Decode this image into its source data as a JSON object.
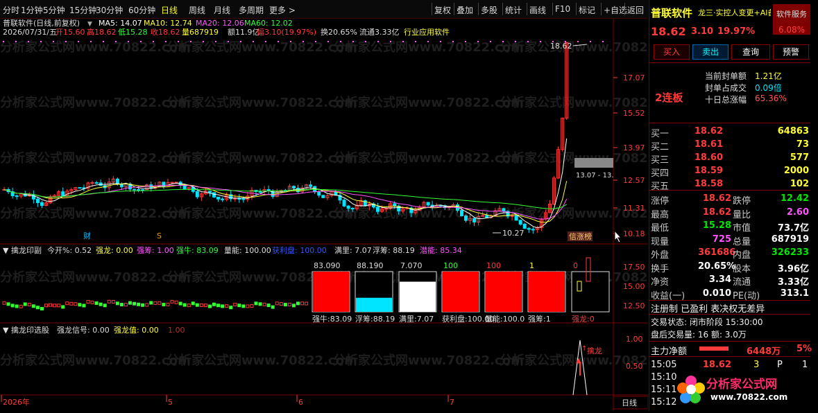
{
  "toolbar": {
    "left_tabs": [
      "分时",
      "1分钟",
      "5分钟",
      "15分钟",
      "30分钟",
      "60分钟",
      "日线",
      "周线",
      "月线",
      "多周期",
      "更多 >"
    ],
    "right_tabs": [
      "复权",
      "叠加",
      "多股",
      "统计",
      "画线",
      "F10",
      "标记",
      "+自选",
      "返回"
    ]
  },
  "main": {
    "title": "普联软件(日线,前复权)",
    "ma": [
      {
        "label": "MA5: 14.07",
        "color": "#ffffff"
      },
      {
        "label": "MA10: 12.74",
        "color": "#ffff33"
      },
      {
        "label": "MA20: 12.06",
        "color": "#ff55ff"
      },
      {
        "label": "MA60: 12.02",
        "color": "#33ff33"
      }
    ],
    "info_date": "2026/07/31/五",
    "info_open": "开15.60",
    "info_high": "高18.62",
    "info_low": "低15.28",
    "info_close": "收18.62",
    "info_vol": "量687919",
    "info_amount": "额11.9亿",
    "info_change": "幅3.10(19.97%)",
    "info_turnover": "换20.65%",
    "info_float": "流通3.33亿",
    "info_industry": "行业应用软件",
    "y_ticks": [
      "17.07",
      "15.52",
      "13.97",
      "12.57",
      "11.31",
      "10.18"
    ],
    "high_label": "18.62",
    "low_label": "10.27",
    "range_label": "13.07 - 13.",
    "marker_cai": "财",
    "marker_s": "S",
    "marker_xin": "信涨榜",
    "watermark": "分析家公式网www.70822.com"
  },
  "panel2": {
    "title": "擒龙印副",
    "items": [
      {
        "text": "今开%: 0.52",
        "color": "#dddddd"
      },
      {
        "text": "强龙: 0.00",
        "color": "#ffff33"
      },
      {
        "text": "强筹: 1.00",
        "color": "#ff55ff"
      },
      {
        "text": "强牛: 83.09",
        "color": "#33ff33"
      },
      {
        "text": "量能: 100.00",
        "color": "#dddddd"
      },
      {
        "text": "获利盘: 100.00",
        "color": "#3355ff"
      },
      {
        "text": "满里: 7.07",
        "color": "#dddddd"
      },
      {
        "text": "浮筹: 88.19",
        "color": "#dddddd"
      },
      {
        "text": "潜能: 85.34",
        "color": "#ff55ff"
      }
    ],
    "y_ticks": [
      "17.50",
      "15.00",
      "12.50"
    ],
    "boxes": [
      {
        "top": "83.090",
        "bottom": "强牛:83.09",
        "top_color": "#dddddd",
        "fill": "#ff0000",
        "fill_level": 1.0
      },
      {
        "top": "88.190",
        "bottom": "浮筹:88.19",
        "top_color": "#dddddd",
        "fill": "#00e5ff",
        "fill_level": 0.35
      },
      {
        "top": "7.070",
        "bottom": "满里:7.07",
        "top_color": "#dddddd",
        "fill": "#ffffff",
        "fill_level": 0.75
      },
      {
        "top": "100",
        "bottom": "获利盘:100.00",
        "top_color": "#33ff33",
        "fill": "#ff0000",
        "fill_level": 1.0
      },
      {
        "top": "100",
        "bottom": "量能:100.0",
        "top_color": "#ff3b3b",
        "fill": "#ff0000",
        "fill_level": 1.0
      },
      {
        "top": "1",
        "bottom": "强筹:1",
        "top_color": "#ffff33",
        "fill": "#ff0000",
        "fill_level": 1.0
      },
      {
        "top": "0",
        "bottom": "强龙:0",
        "top_color": "#ff3b3b",
        "fill": "#000000",
        "fill_level": 0.0
      }
    ]
  },
  "panel3": {
    "title": "擒龙印选股",
    "items": [
      {
        "text": "强龙信号: 0.00",
        "color": "#dddddd"
      },
      {
        "text": "强龙值: 0.00",
        "color": "#ffff33"
      },
      {
        "text": "1.00",
        "color": "#aa3333"
      }
    ],
    "y_ticks": [
      "1.00",
      "0.50"
    ],
    "signal_label": "擒龙"
  },
  "x_axis": {
    "labels": [
      "2026年",
      "5",
      "6",
      "7"
    ],
    "period": "日线"
  },
  "quote": {
    "name": "普联软件",
    "tags": "龙三·实控人变更+AI备",
    "badge": "软件服务",
    "price": "18.62",
    "change": "3.10",
    "pct": "19.97%",
    "badge_pct": "6.08%",
    "buttons": [
      "买入",
      "卖出",
      "查询",
      "预警"
    ],
    "seal_amount_label": "当前封单额",
    "seal_amount": "1.21亿",
    "seal_ratio_label": "封单占成交",
    "seal_ratio": "0.09倍",
    "ten_day_label": "十日总涨幅",
    "ten_day": "65.36%",
    "streak": "2连板",
    "book": [
      {
        "label": "买一",
        "price": "18.62",
        "vol": "64863"
      },
      {
        "label": "买二",
        "price": "18.61",
        "vol": "73"
      },
      {
        "label": "买三",
        "price": "18.60",
        "vol": "577"
      },
      {
        "label": "买四",
        "price": "18.59",
        "vol": "2000"
      },
      {
        "label": "买五",
        "price": "18.58",
        "vol": "102"
      }
    ],
    "stats": [
      {
        "l1": "涨停",
        "v1": "18.62",
        "c1": "red",
        "l2": "跌停",
        "v2": "12.42",
        "c2": "green"
      },
      {
        "l1": "最高",
        "v1": "18.62",
        "c1": "red",
        "l2": "量比",
        "v2": "2.60",
        "c2": "magenta"
      },
      {
        "l1": "最低",
        "v1": "15.28",
        "c1": "green",
        "l2": "市值",
        "v2": "73.7亿",
        "c2": "white"
      },
      {
        "l1": "现量",
        "v1": "725",
        "c1": "magenta",
        "l2": "总量",
        "v2": "687919",
        "c2": "white"
      },
      {
        "l1": "外盘",
        "v1": "361686",
        "c1": "red",
        "l2": "内盘",
        "v2": "326233",
        "c2": "green"
      },
      {
        "l1": "换手",
        "v1": "20.65%",
        "c1": "white",
        "l2": "股本",
        "v2": "3.96亿",
        "c2": "white"
      },
      {
        "l1": "净资",
        "v1": "3.34",
        "c1": "white",
        "l2": "流通",
        "v2": "3.33亿",
        "c2": "white"
      },
      {
        "l1": "收益(一)",
        "v1": "0.010",
        "c1": "white",
        "l2": "PE(动)",
        "v2": "313.1",
        "c2": "white"
      }
    ],
    "reg_line": "注册制 已盈利 表决权无差异",
    "trade_status": "交易状态: 闭市阶段 15:30:00",
    "after_hours": "盘后交易量: 16  额: 3.0万",
    "main_flow_label": "主力净额",
    "main_flow_value": "6448万",
    "main_flow_pct": "5%",
    "ticks": [
      {
        "time": "15:05",
        "price": "18.62",
        "vol": "3",
        "flag": "P",
        "n": "1"
      },
      {
        "time": "15:10",
        "price": "",
        "vol": "",
        "flag": "",
        "n": ""
      },
      {
        "time": "15:11",
        "price": "",
        "vol": "",
        "flag": "",
        "n": ""
      },
      {
        "time": "15:12",
        "price": "",
        "vol": "",
        "flag": "",
        "n": ""
      }
    ],
    "logo_text": "分析家公式网",
    "logo_url": "www.70822.com"
  }
}
